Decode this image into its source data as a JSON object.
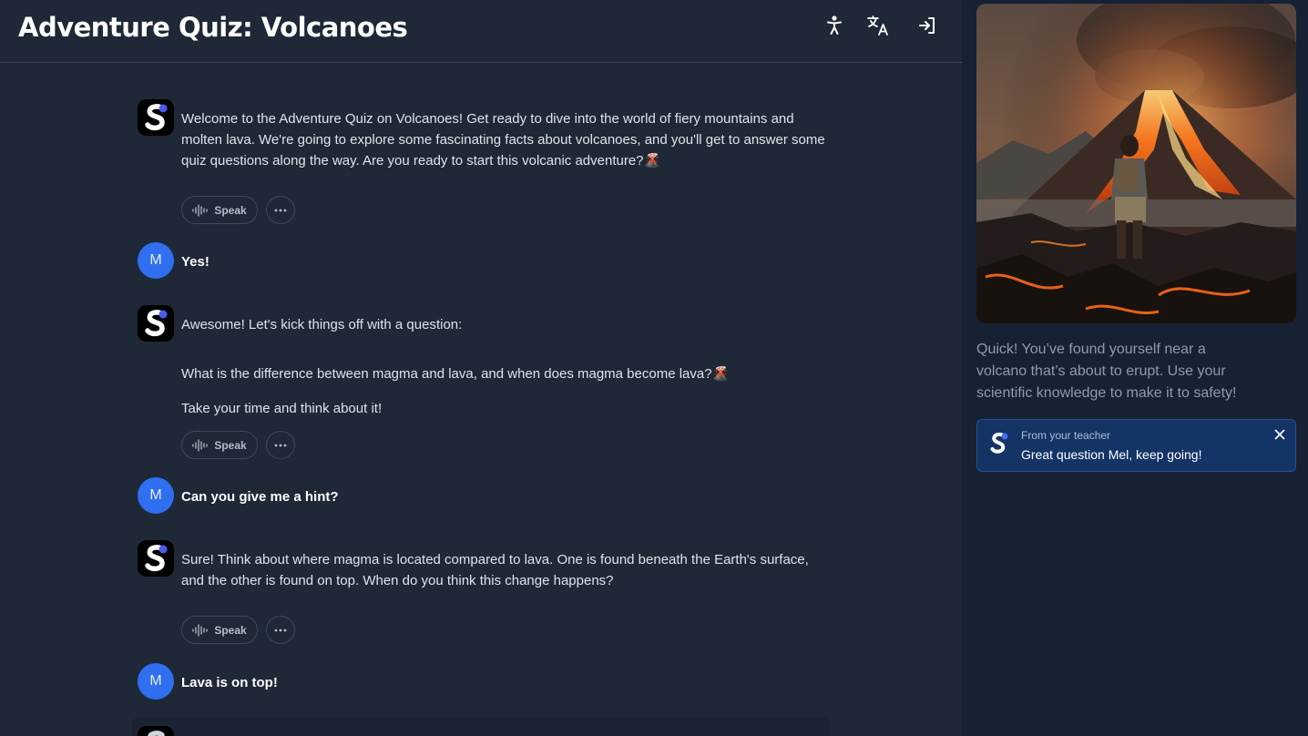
{
  "header": {
    "title": "Adventure Quiz: Volcanoes",
    "icons": [
      "accessibility-icon",
      "translate-icon",
      "exit-icon"
    ]
  },
  "chat": {
    "messages": [
      {
        "role": "assistant",
        "paragraphs": [
          "Welcome to the Adventure Quiz on Volcanoes! Get ready to dive into the world of fiery mountains and molten lava. We're going to explore some fascinating facts about volcanoes, and you'll get to answer some quiz questions along the way. Are you ready to start this volcanic adventure?🌋"
        ],
        "speak_label": "Speak"
      },
      {
        "role": "user",
        "avatar": "M",
        "text": "Yes!"
      },
      {
        "role": "assistant",
        "paragraphs": [
          "Awesome! Let's kick things off with a question:",
          "What is the difference between magma and lava, and when does magma become lava?🌋",
          "Take your time and think about it!"
        ],
        "speak_label": "Speak"
      },
      {
        "role": "user",
        "avatar": "M",
        "text": "Can you give me a hint?"
      },
      {
        "role": "assistant",
        "paragraphs": [
          "Sure! Think about where magma is located compared to lava. One is found beneath the Earth's surface, and the other is found on top. When do you think this change happens?"
        ],
        "speak_label": "Speak"
      },
      {
        "role": "user",
        "avatar": "M",
        "text": "Lava is on top!"
      }
    ]
  },
  "side": {
    "scene_text": "Quick! You’ve found yourself near a volcano that’s about to erupt. Use your scientific knowledge to make it to safety!",
    "teacher_note": {
      "from": "From your teacher",
      "message": "Great question Mel, keep going!"
    }
  },
  "colors": {
    "background": "#1e2837",
    "sidebar": "#162133",
    "user_avatar": "#2f6ff0",
    "teacher_card": "#143466"
  }
}
